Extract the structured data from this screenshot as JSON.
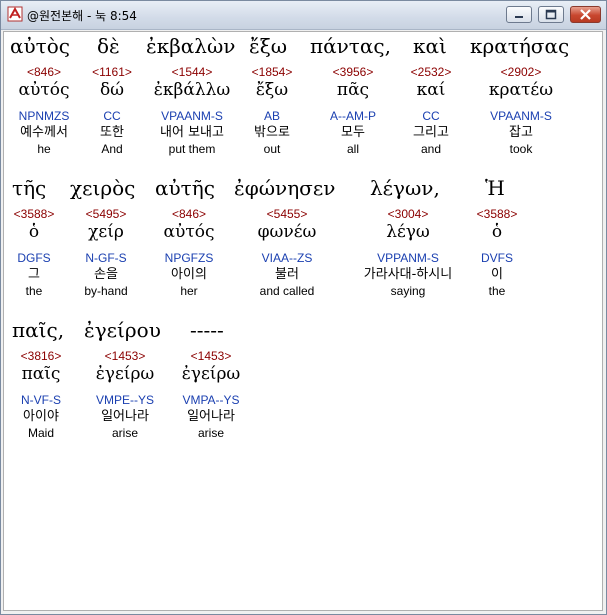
{
  "window": {
    "title": "@원전본해 - 눅 8:54"
  },
  "rows": [
    {
      "greek_line": [
        "αὐτὸς",
        "δὲ",
        "ἐκβαλὼν",
        "ἔξω",
        "πάντας,",
        "καὶ",
        "κρατήσας"
      ],
      "words": [
        {
          "num": "<846>",
          "lemma": "αὐτός",
          "pos": "NPNMZS",
          "ko": "예수께서",
          "en": "he"
        },
        {
          "num": "<1161>",
          "lemma": "δώ",
          "pos": "CC",
          "ko": "또한",
          "en": "And"
        },
        {
          "num": "<1544>",
          "lemma": "ἐκβάλλω",
          "pos": "VPAANM-S",
          "ko": "내어 보내고",
          "en": "put them"
        },
        {
          "num": "<1854>",
          "lemma": "ἔξω",
          "pos": "AB",
          "ko": "밖으로",
          "en": "out"
        },
        {
          "num": "<3956>",
          "lemma": "πᾶς",
          "pos": "A--AM-P",
          "ko": "모두",
          "en": "all"
        },
        {
          "num": "<2532>",
          "lemma": "καί",
          "pos": "CC",
          "ko": "그리고",
          "en": "and"
        },
        {
          "num": "<2902>",
          "lemma": "κρατέω",
          "pos": "VPAANM-S",
          "ko": "잡고",
          "en": "took"
        }
      ]
    },
    {
      "greek_line": [
        "τῆς",
        "χειρὸς",
        "αὐτῆς",
        "ἐφώνησεν",
        "λέγων,",
        "Ἡ"
      ],
      "words": [
        {
          "num": "<3588>",
          "lemma": "ὁ",
          "pos": "DGFS",
          "ko": "그",
          "en": "the"
        },
        {
          "num": "<5495>",
          "lemma": "χείρ",
          "pos": "N-GF-S",
          "ko": "손을",
          "en": "by-hand"
        },
        {
          "num": "<846>",
          "lemma": "αὐτός",
          "pos": "NPGFZS",
          "ko": "아이의",
          "en": "her"
        },
        {
          "num": "<5455>",
          "lemma": "φωνέω",
          "pos": "VIAA--ZS",
          "ko": "불러",
          "en": "and called"
        },
        {
          "num": "<3004>",
          "lemma": "λέγω",
          "pos": "VPPANM-S",
          "ko": "가라사대-하시니",
          "en": "saying"
        },
        {
          "num": "<3588>",
          "lemma": "ὁ",
          "pos": "DVFS",
          "ko": "이",
          "en": "the"
        }
      ]
    },
    {
      "greek_line": [
        "παῖς,",
        "ἐγείρου",
        "-----"
      ],
      "words": [
        {
          "num": "<3816>",
          "lemma": "παῖς",
          "pos": "N-VF-S",
          "ko": "아이야",
          "en": "Maid"
        },
        {
          "num": "<1453>",
          "lemma": "ἐγείρω",
          "pos": "VMPE--YS",
          "ko": "일어나라",
          "en": "arise"
        },
        {
          "num": "<1453>",
          "lemma": "ἐγείρω",
          "pos": "VMPA--YS",
          "ko": "일어나라",
          "en": "arise"
        }
      ]
    }
  ]
}
